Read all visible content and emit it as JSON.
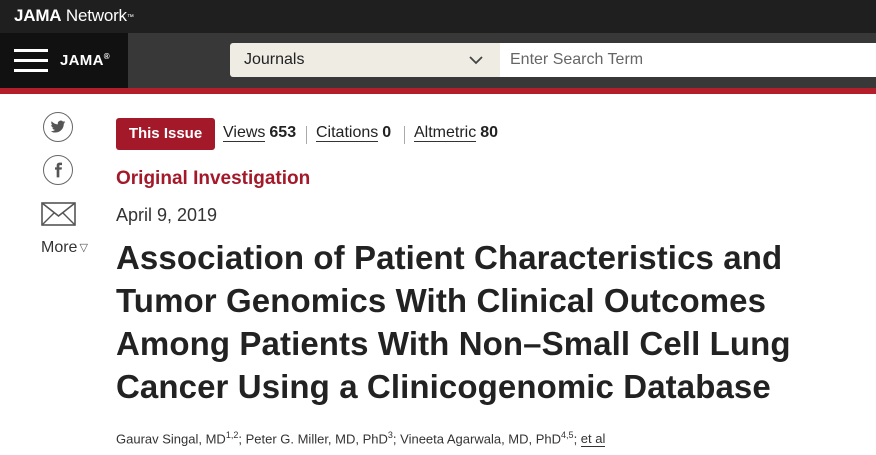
{
  "network": {
    "brand": "JAMA",
    "suffix": "Network",
    "mark": "™"
  },
  "header": {
    "journal_name": "JAMA",
    "journal_mark": "®",
    "journals_label": "Journals",
    "search_placeholder": "Enter Search Term"
  },
  "share": {
    "more_label": "More",
    "more_icon": "triangle-down"
  },
  "metrics": {
    "issue_badge": "This Issue",
    "views_label": "Views",
    "views_value": "653",
    "citations_label": "Citations",
    "citations_value": "0",
    "altmetric_label": "Altmetric",
    "altmetric_value": "80"
  },
  "article": {
    "type": "Original Investigation",
    "date": "April 9, 2019",
    "title": "Association of Patient Characteristics and Tumor Genomics With Clinical Outcomes Among Patients With Non–Small Cell Lung Cancer Using a Clinicogenomic Database",
    "authors": [
      {
        "name": "Gaurav Singal, MD",
        "sup": "1,2"
      },
      {
        "name": "Peter G. Miller, MD, PhD",
        "sup": "3"
      },
      {
        "name": "Vineeta Agarwala, MD, PhD",
        "sup": "4,5"
      }
    ],
    "et_al": "et al"
  },
  "colors": {
    "accent_red": "#a3192a",
    "rule_red": "#b41e2a",
    "header_dark": "#383838",
    "topbar": "#1f1f1f"
  },
  "icons": [
    "menu-icon",
    "chevron-down-icon",
    "twitter-icon",
    "facebook-icon",
    "email-icon"
  ]
}
